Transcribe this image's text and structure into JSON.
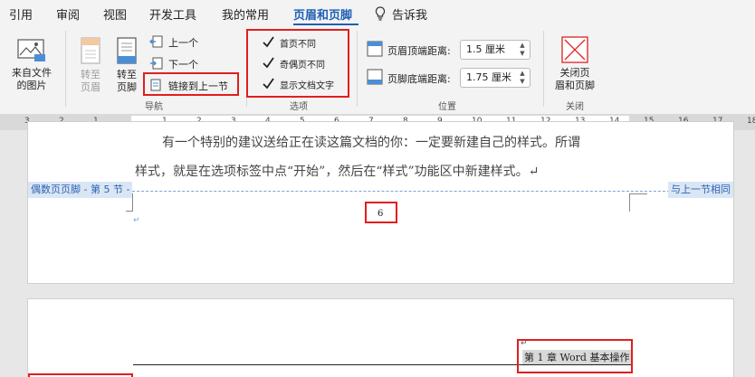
{
  "tabs": [
    "引用",
    "审阅",
    "视图",
    "开发工具",
    "我的常用",
    "页眉和页脚",
    "告诉我"
  ],
  "ribbon": {
    "from_file": "来自文件\n的图片",
    "goto_header": "转至\n页眉",
    "goto_footer": "转至\n页脚",
    "previous": "上一个",
    "next": "下一个",
    "link_previous": "链接到上一节",
    "nav_group": "导航",
    "first_page_diff": "首页不同",
    "odd_even_diff": "奇偶页不同",
    "show_doc_text": "显示文档文字",
    "options_group": "选项",
    "header_top_label": "页眉顶端距离:",
    "header_top_value": "1.5 厘米",
    "footer_bottom_label": "页脚底端距离:",
    "footer_bottom_value": "1.75 厘米",
    "position_group": "位置",
    "close_label": "关闭页\n眉和页脚",
    "close_group": "关闭",
    "checkbox_states": [
      true,
      true,
      true
    ]
  },
  "ruler": [
    "3",
    "2",
    "1",
    "1",
    "2",
    "3",
    "4",
    "5",
    "6",
    "7",
    "8",
    "9",
    "10",
    "11",
    "12",
    "13",
    "14",
    "15",
    "16",
    "17",
    "18"
  ],
  "doc": {
    "line1": "有一个特别的建议送给正在读这篇文档的你：一定要新建自己的样式。所谓",
    "line2": "样式，就是在选项标签中点“开始”，然后在“样式”功能区中新建样式。↵",
    "footer_tag": "偶数页页脚 - 第 5 节 -",
    "same_as_prev": "与上一节相同",
    "page_number": "6",
    "para_mark": "↵",
    "header_text": "第 1 章 Word 基本操作"
  }
}
